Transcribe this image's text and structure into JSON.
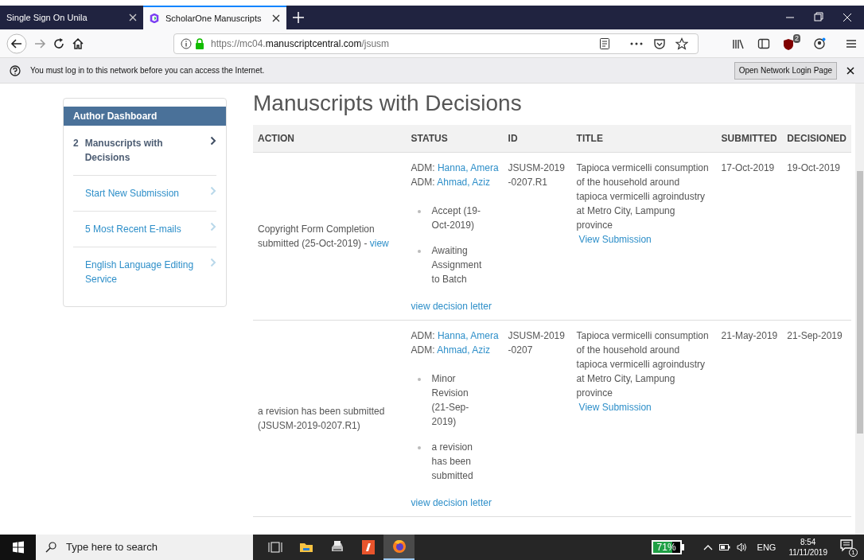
{
  "browser": {
    "tabs": [
      {
        "title": "Single Sign On Unila",
        "selected": false
      },
      {
        "title": "ScholarOne Manuscripts",
        "selected": true
      }
    ],
    "url": {
      "prefix": "https://mc04.",
      "domain": "manuscriptcentral.com",
      "path": "/jsusm"
    },
    "extension_badge": "2",
    "notification": {
      "message": "You must log in to this network before you can access the Internet.",
      "button": "Open Network Login Page"
    }
  },
  "sidebar": {
    "title": "Author Dashboard",
    "items": [
      {
        "count": "2",
        "label": "Manuscripts with Decisions",
        "selected": true
      },
      {
        "label": "Start New Submission",
        "selected": false
      },
      {
        "label": "5 Most Recent E-mails",
        "selected": false
      },
      {
        "label": "English Language Editing Service",
        "selected": false
      }
    ]
  },
  "page_title": "Manuscripts with Decisions",
  "table": {
    "columns": [
      "ACTION",
      "STATUS",
      "ID",
      "TITLE",
      "SUBMITTED",
      "DECISIONED"
    ],
    "rows": [
      {
        "action": {
          "text": "Copyright Form Completion submitted (25-Oct-2019) - ",
          "link": "view"
        },
        "admins": [
          {
            "prefix": "ADM:",
            "name": "Hanna, Amera"
          },
          {
            "prefix": "ADM:",
            "name": "Ahmad, Aziz"
          }
        ],
        "status_items": [
          "Accept (19-Oct-2019)",
          "Awaiting Assignment to Batch"
        ],
        "decision_link": "view decision letter",
        "id": "JSUSM-2019-0207.R1",
        "title": "Tapioca vermicelli consumption of the household around tapioca vermicelli agroindustry at Metro City, Lampung province",
        "title_link": "View Submission",
        "submitted": "17-Oct-2019",
        "decisioned": "19-Oct-2019"
      },
      {
        "action": {
          "text": "a revision has been submitted (JSUSM-2019-0207.R1)"
        },
        "admins": [
          {
            "prefix": "ADM:",
            "name": "Hanna, Amera"
          },
          {
            "prefix": "ADM:",
            "name": "Ahmad, Aziz"
          }
        ],
        "status_items": [
          "Minor Revision (21-Sep-2019)",
          "a revision has been submitted"
        ],
        "decision_link": "view decision letter",
        "id": "JSUSM-2019-0207",
        "title": "Tapioca vermicelli consumption of the household around tapioca vermicelli agroindustry at Metro City, Lampung province",
        "title_link": "View Submission",
        "submitted": "21-May-2019",
        "decisioned": "21-Sep-2019"
      }
    ]
  },
  "taskbar": {
    "search_placeholder": "Type here to search",
    "battery": "71%",
    "language": "ENG",
    "time": "8:54",
    "date": "11/11/2019",
    "notification_count": "1"
  }
}
